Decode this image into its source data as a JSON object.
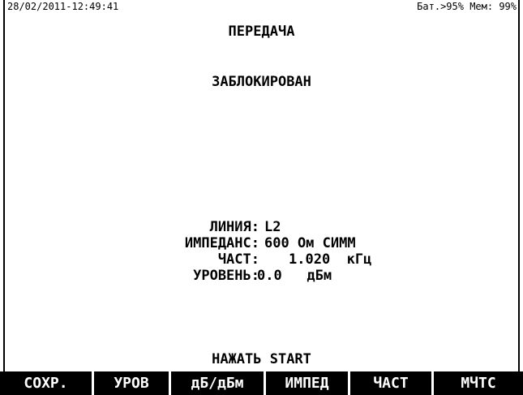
{
  "header": {
    "datetime": "28/02/2011-12:49:41",
    "status": "Бат.>95% Мем: 99%",
    "title": "ПЕРЕДАЧА"
  },
  "main": {
    "state": "ЗАБЛОКИРОВАН",
    "params": {
      "line_label": "ЛИНИЯ:",
      "line_value": "L2",
      "impedance_label": "ИМПЕДАНС:",
      "impedance_value": "600 Ом СИММ",
      "frequency_label": "ЧАСТ:",
      "frequency_value": "1.020  кГц",
      "level_label": "УРОВЕНЬ:",
      "level_value": "0.0   дБм"
    },
    "prompt": "НАЖАТЬ START"
  },
  "softkeys": [
    "СОХР.",
    "УРОВ",
    "дБ/дБм",
    "ИМПЕД",
    "ЧАСТ",
    "МЧТС"
  ],
  "colors": {
    "background": "#ffffff",
    "foreground": "#000000",
    "softkey_bar": "#000000",
    "softkey_text": "#ffffff"
  }
}
